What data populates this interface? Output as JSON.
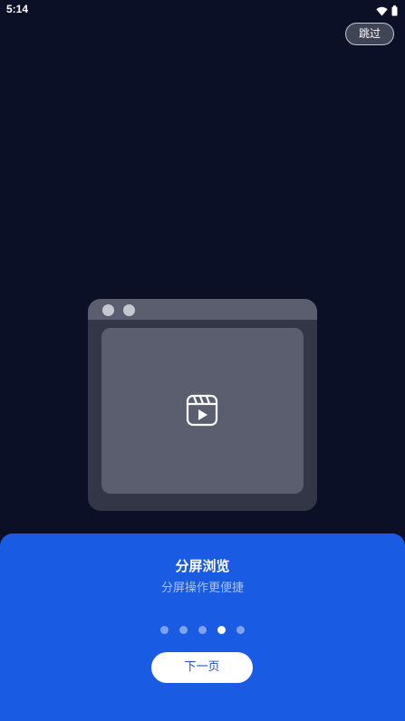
{
  "status_bar": {
    "time": "5:14",
    "icons": [
      "wifi-icon",
      "battery-icon"
    ]
  },
  "skip": {
    "label": "跳过"
  },
  "illustration": {
    "icon": "video-play-icon"
  },
  "onboarding": {
    "title": "分屏浏览",
    "subtitle": "分屏操作更便捷",
    "page_count": 5,
    "current_page": 4
  },
  "next": {
    "label": "下一页"
  },
  "colors": {
    "background": "#0c1027",
    "card": "#1a5be3",
    "accent_text": "#1f4fc0"
  }
}
